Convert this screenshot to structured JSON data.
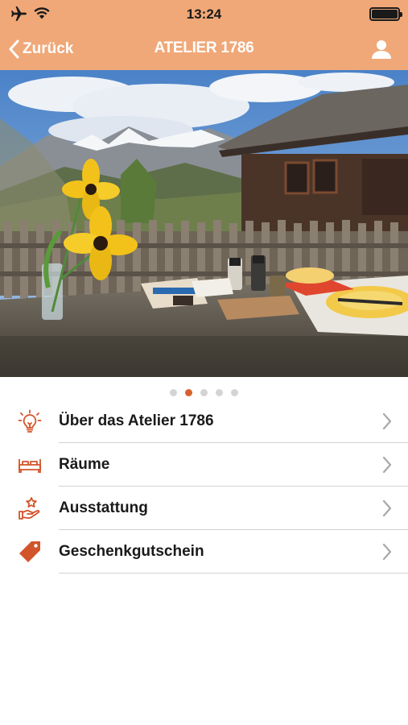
{
  "status_bar": {
    "time": "13:24"
  },
  "navbar": {
    "back_label": "Zurück",
    "title": "ATELIER 1786"
  },
  "carousel": {
    "page_count": 5,
    "active_page": 2
  },
  "menu": {
    "items": [
      {
        "label": "Über das Atelier 1786",
        "icon": "lightbulb-icon"
      },
      {
        "label": "Räume",
        "icon": "bed-icon"
      },
      {
        "label": "Ausstattung",
        "icon": "hand-star-icon"
      },
      {
        "label": "Geschenkgutschein",
        "icon": "tag-icon"
      }
    ]
  },
  "colors": {
    "header": "#f0a878",
    "accent": "#d8602e",
    "icon": "#d2542a"
  }
}
